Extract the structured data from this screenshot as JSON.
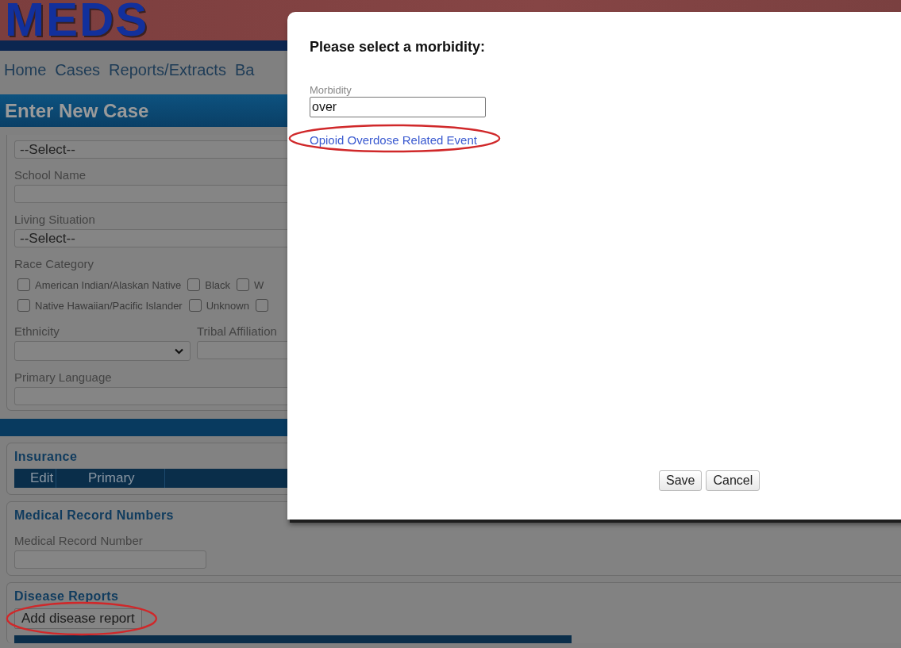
{
  "banner": {
    "logo": "MEDS"
  },
  "nav": [
    "Home",
    "Cases",
    "Reports/Extracts",
    "Ba"
  ],
  "page_title": "Enter New Case",
  "form_fields": [
    {
      "kind": "select",
      "value": "--Select--"
    },
    {
      "kind": "text",
      "label": "School Name"
    },
    {
      "kind": "select",
      "label": "Living Situation",
      "value": "--Select--"
    },
    {
      "kind": "checkboxes",
      "label": "Race Category",
      "rows": [
        [
          {
            "label": "American Indian/Alaskan Native",
            "checked": false
          },
          {
            "label": "Black",
            "checked": false
          },
          {
            "label": "W",
            "checked": false
          }
        ],
        [
          {
            "label": "Native Hawaiian/Pacific Islander",
            "checked": false
          },
          {
            "label": "Unknown",
            "checked": false
          },
          {
            "checked": false
          }
        ]
      ]
    },
    {
      "kind": "pair",
      "items": [
        {
          "kind": "dropdown",
          "label": "Ethnicity"
        },
        {
          "kind": "text",
          "label": "Tribal Affiliation"
        }
      ]
    },
    {
      "kind": "text",
      "label": "Primary Language"
    }
  ],
  "insurance": {
    "title": "Insurance",
    "columns": [
      "Edit",
      "Primary"
    ]
  },
  "medical_records": {
    "title": "Medical Record Numbers",
    "fields": [
      {
        "label": "Medical Record Number"
      }
    ]
  },
  "disease_reports": {
    "title": "Disease Reports",
    "add_button": {
      "label": "Add disease report",
      "circled": true
    }
  },
  "modal": {
    "title": "Please select a morbidity:",
    "field": {
      "label": "Morbidity",
      "value": "over"
    },
    "suggestions": [
      {
        "label": "Opioid Overdose Related Event",
        "circled": true
      }
    ],
    "buttons": [
      "Save",
      "Cancel"
    ]
  }
}
